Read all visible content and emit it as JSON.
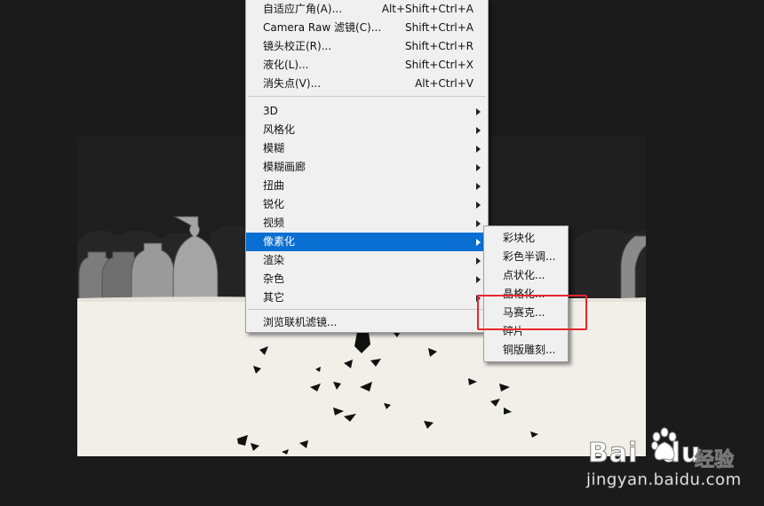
{
  "main_menu": {
    "items": [
      {
        "label": "自适应广角(A)...",
        "shortcut": "Alt+Shift+Ctrl+A"
      },
      {
        "label": "Camera Raw 滤镜(C)...",
        "shortcut": "Shift+Ctrl+A"
      },
      {
        "label": "镜头校正(R)...",
        "shortcut": "Shift+Ctrl+R"
      },
      {
        "label": "液化(L)...",
        "shortcut": "Shift+Ctrl+X"
      },
      {
        "label": "消失点(V)...",
        "shortcut": "Alt+Ctrl+V"
      },
      {
        "label": "3D"
      },
      {
        "label": "风格化"
      },
      {
        "label": "模糊"
      },
      {
        "label": "模糊画廊"
      },
      {
        "label": "扭曲"
      },
      {
        "label": "锐化"
      },
      {
        "label": "视频"
      },
      {
        "label": "像素化"
      },
      {
        "label": "渲染"
      },
      {
        "label": "杂色"
      },
      {
        "label": "其它"
      },
      {
        "label": "浏览联机滤镜..."
      }
    ]
  },
  "submenu": {
    "items": [
      {
        "label": "彩块化"
      },
      {
        "label": "彩色半调..."
      },
      {
        "label": "点状化..."
      },
      {
        "label": "晶格化..."
      },
      {
        "label": "马赛克..."
      },
      {
        "label": "碎片"
      },
      {
        "label": "铜版雕刻..."
      }
    ]
  },
  "watermark": {
    "logo": "Bai",
    "logo_suffix": "du",
    "brand": "经验",
    "url": "jingyan.baidu.com"
  },
  "colors": {
    "menu_bg": "#f0f0f0",
    "highlight": "#0a6fd3",
    "annotation_box": "#e8262c",
    "workspace": "#1b1b1b"
  }
}
